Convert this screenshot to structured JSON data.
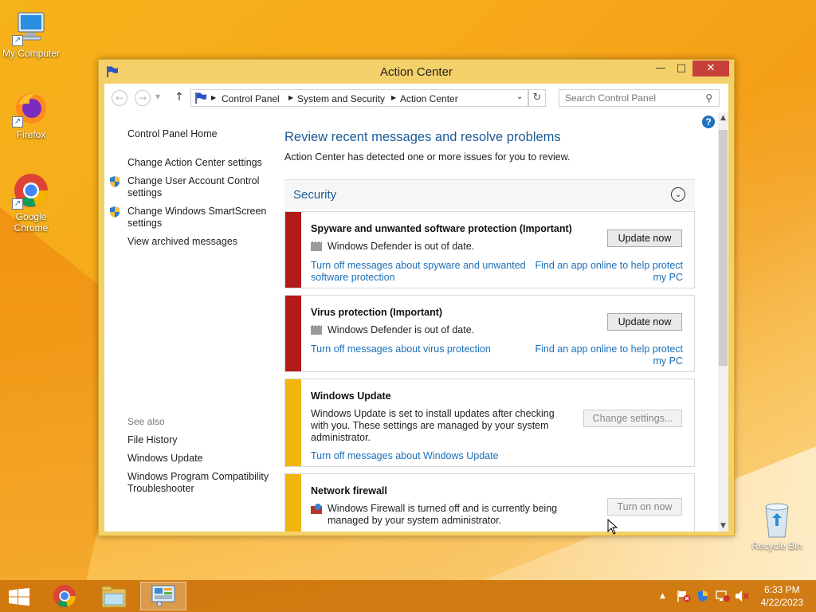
{
  "desktop": {
    "icons": [
      {
        "label": "My Computer"
      },
      {
        "label": "Firefox"
      },
      {
        "label": "Google Chrome"
      },
      {
        "label": "Recycle Bin"
      }
    ]
  },
  "window": {
    "title": "Action Center",
    "minimize": "—",
    "maximize": "□",
    "close": "✕"
  },
  "nav": {
    "breadcrumb": [
      "Control Panel",
      "System and Security",
      "Action Center"
    ],
    "search_placeholder": "Search Control Panel"
  },
  "sidebar": {
    "home": "Control Panel Home",
    "items": [
      "Change Action Center settings",
      "Change User Account Control settings",
      "Change Windows SmartScreen settings",
      "View archived messages"
    ],
    "see_also_label": "See also",
    "see_also": [
      "File History",
      "Windows Update",
      "Windows Program Compatibility Troubleshooter"
    ]
  },
  "main": {
    "heading": "Review recent messages and resolve problems",
    "subheading": "Action Center has detected one or more issues for you to review.",
    "section": "Security",
    "cards": [
      {
        "title": "Spyware and unwanted software protection  (Important)",
        "text": "Windows Defender is out of date.",
        "link_left": "Turn off messages about spyware and unwanted software protection",
        "link_right": "Find an app online to help protect my PC",
        "button": "Update now",
        "color": "#b31b1b"
      },
      {
        "title": "Virus protection  (Important)",
        "text": "Windows Defender is out of date.",
        "link_left": "Turn off messages about virus protection",
        "link_right": "Find an app online to help protect my PC",
        "button": "Update now",
        "color": "#b31b1b"
      },
      {
        "title": "Windows Update",
        "text": "Windows Update is set to install updates after checking with you.  These settings are managed by your system administrator.",
        "link_left": "Turn off messages about Windows Update",
        "button": "Change settings...",
        "color": "#f2b50c"
      },
      {
        "title": "Network firewall",
        "text": "Windows Firewall is turned off and is currently being managed by your system administrator.",
        "button": "Turn on now",
        "color": "#f2b50c"
      }
    ]
  },
  "taskbar": {
    "time": "6:33 PM",
    "date": "4/22/2023"
  }
}
